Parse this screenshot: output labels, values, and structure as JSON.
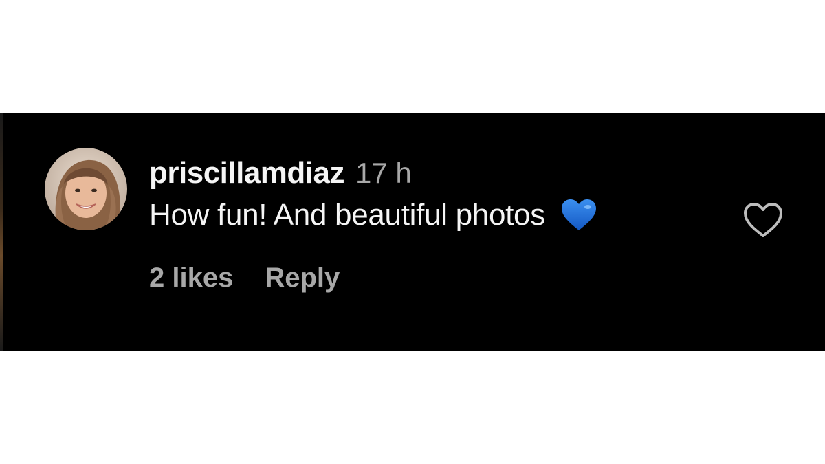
{
  "comment": {
    "username": "priscillamdiaz",
    "timestamp": "17 h",
    "text": "How fun! And beautiful photos",
    "emoji": "blue-heart-emoji",
    "likes": "2 likes",
    "reply_label": "Reply"
  },
  "icons": {
    "like": "heart-outline-icon",
    "avatar": "profile-avatar"
  },
  "colors": {
    "background": "#000000",
    "primary_text": "#f5f5f5",
    "secondary_text": "#a8a8a8",
    "emoji_blue": "#1e6fd8"
  }
}
